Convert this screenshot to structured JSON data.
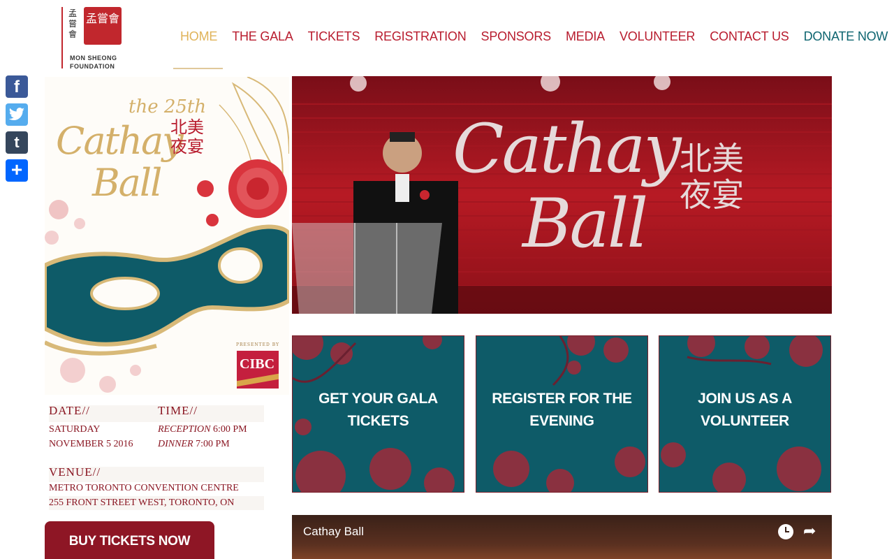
{
  "logo": {
    "chinese_vertical": "孟嘗會",
    "seal_text": "孟嘗會",
    "name_line1": "MON SHEONG",
    "name_line2": "FOUNDATION"
  },
  "nav": {
    "items": [
      {
        "label": "HOME"
      },
      {
        "label": "THE GALA"
      },
      {
        "label": "TICKETS"
      },
      {
        "label": "REGISTRATION"
      },
      {
        "label": "SPONSORS"
      },
      {
        "label": "MEDIA"
      },
      {
        "label": "VOLUNTEER"
      },
      {
        "label": "CONTACT US"
      },
      {
        "label": "DONATE NOW"
      }
    ],
    "active": "HOME"
  },
  "share": {
    "facebook": "f",
    "twitter": "t",
    "tumblr": "t",
    "share": "+"
  },
  "poster": {
    "edition": "the 25th",
    "title_line1": "Cathay",
    "title_line2": "Ball",
    "chinese": "北美夜宴",
    "presented_by": "PRESENTED BY",
    "sponsor": "CIBC"
  },
  "event": {
    "date_label": "DATE//",
    "date_line1": "SATURDAY",
    "date_line2": "NOVEMBER 5 2016",
    "time_label": "TIME//",
    "reception_label": "RECEPTION",
    "reception_time": "6:00 PM",
    "dinner_label": "DINNER",
    "dinner_time": "7:00 PM",
    "venue_label": "VENUE//",
    "venue_line1": "METRO TORONTO CONVENTION CENTRE",
    "venue_line2": "255 FRONT STREET WEST, TORONTO, ON"
  },
  "buy_button": "BUY TICKETS NOW",
  "hero": {
    "title_line1": "Cathay",
    "title_line2": "Ball",
    "chinese": "北美夜宴"
  },
  "tiles": [
    {
      "label": "GET YOUR GALA TICKETS"
    },
    {
      "label": "REGISTER FOR THE EVENING"
    },
    {
      "label": "JOIN US AS A VOLUNTEER"
    }
  ],
  "video": {
    "title": "Cathay Ball"
  },
  "colors": {
    "brand_red": "#b81c2e",
    "gold": "#e0b359",
    "teal": "#0e5b68",
    "dark_red": "#8e1625"
  }
}
